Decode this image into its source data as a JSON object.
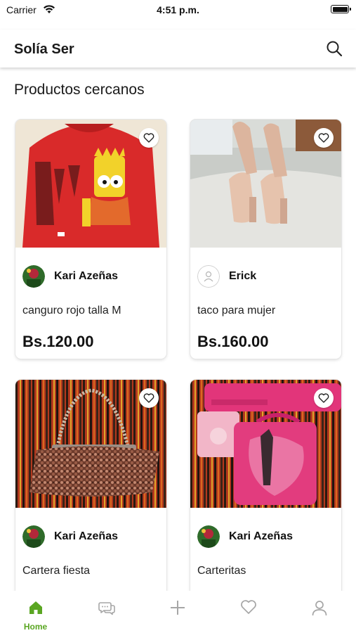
{
  "status_bar": {
    "carrier": "Carrier",
    "time": "4:51 p.m."
  },
  "header": {
    "title": "Solía Ser"
  },
  "section": {
    "title": "Productos cercanos"
  },
  "products": [
    {
      "seller": "Kari Azeñas",
      "title": "canguro rojo talla M",
      "price": "Bs.120.00"
    },
    {
      "seller": "Erick",
      "title": "taco para mujer",
      "price": "Bs.160.00"
    },
    {
      "seller": "Kari Azeñas",
      "title": "Cartera fiesta",
      "price": ""
    },
    {
      "seller": "Kari Azeñas",
      "title": "Carteritas",
      "price": ""
    }
  ],
  "tab_bar": {
    "active_color": "#5aa622",
    "inactive_color": "#a6a6a6",
    "tabs": [
      {
        "label": "Home",
        "icon": "home-icon",
        "active": true
      },
      {
        "label": "",
        "icon": "chat-icon",
        "active": false
      },
      {
        "label": "",
        "icon": "plus-icon",
        "active": false
      },
      {
        "label": "",
        "icon": "heart-icon",
        "active": false
      },
      {
        "label": "",
        "icon": "profile-icon",
        "active": false
      }
    ]
  }
}
